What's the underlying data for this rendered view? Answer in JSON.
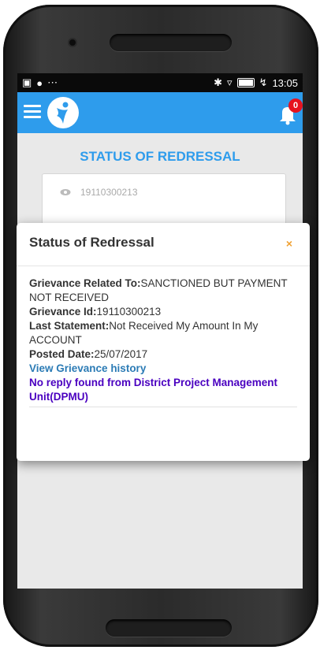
{
  "statusbar": {
    "time": "13:05",
    "left_icons": [
      "image-icon",
      "cat-icon",
      "more-dots-icon"
    ],
    "right_icons": [
      "bluetooth-icon",
      "wifi-icon",
      "battery-icon",
      "charging-icon"
    ]
  },
  "appbar": {
    "color": "#2e9cec",
    "notification_count": "0"
  },
  "page": {
    "title": "STATUS OF REDRESSAL",
    "card_value": "19110300213"
  },
  "modal": {
    "title": "Status of Redressal",
    "close_label": "×",
    "related_label": "Grievance Related To:",
    "related_value": "SANCTIONED BUT PAYMENT NOT RECEIVED",
    "id_label": "Grievance Id:",
    "id_value": "19110300213",
    "last_label": "Last Statement:",
    "last_value": "Not Received My Amount In My ACCOUNT",
    "posted_label": "Posted Date:",
    "posted_value": "25/07/2017",
    "history_link": "View Grievance history",
    "reply_text": "No reply found from District Project Management Unit(DPMU)"
  }
}
